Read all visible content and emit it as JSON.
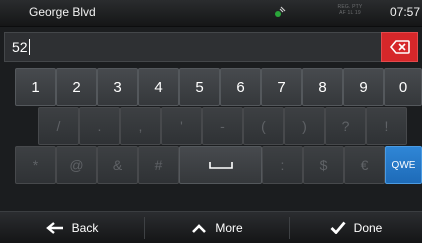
{
  "status_bar": {
    "street_name": "George Blvd",
    "reg_line1": "REG. PTY",
    "reg_line2": "AF 1L 19",
    "time": "07:57",
    "gps_icon": "satellite-icon"
  },
  "input": {
    "value": "52",
    "backspace_icon": "backspace-icon"
  },
  "keyboard": {
    "row1": [
      "1",
      "2",
      "3",
      "4",
      "5",
      "6",
      "7",
      "8",
      "9",
      "0"
    ],
    "row2": [
      "/",
      ".",
      ",",
      "'",
      "-",
      "(",
      ")",
      "?",
      "!"
    ],
    "row3": [
      "*",
      "@",
      "&",
      "#",
      "␣",
      ":",
      "$",
      "€",
      "QWE"
    ],
    "space_label": "⎵",
    "qwe_label": "QWE"
  },
  "nav": {
    "back_label": "Back",
    "more_label": "More",
    "done_label": "Done"
  },
  "colors": {
    "backspace": "#d6272a",
    "qwe_key": "#1e6bb8",
    "background": "#1b1d1f"
  }
}
